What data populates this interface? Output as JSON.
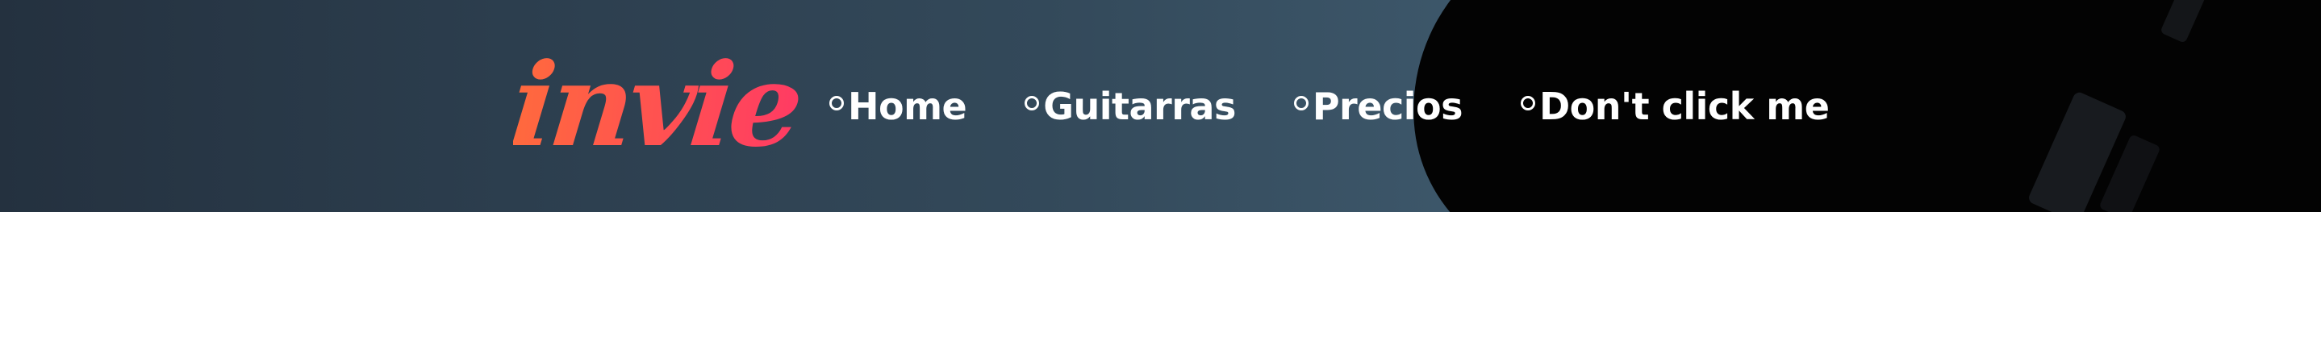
{
  "header": {
    "logo_text": "invie",
    "logo_colors": [
      "#ff6a3d",
      "#ff3b63"
    ],
    "background_colors": [
      "#24313f",
      "#3d586b",
      "#030303"
    ]
  },
  "nav": {
    "items": [
      {
        "label": "Home",
        "icon": "circle-bullet-icon"
      },
      {
        "label": "Guitarras",
        "icon": "circle-bullet-icon"
      },
      {
        "label": "Precios",
        "icon": "circle-bullet-icon"
      },
      {
        "label": "Don't click me",
        "icon": "circle-bullet-icon"
      }
    ],
    "text_color": "#ffffff"
  }
}
